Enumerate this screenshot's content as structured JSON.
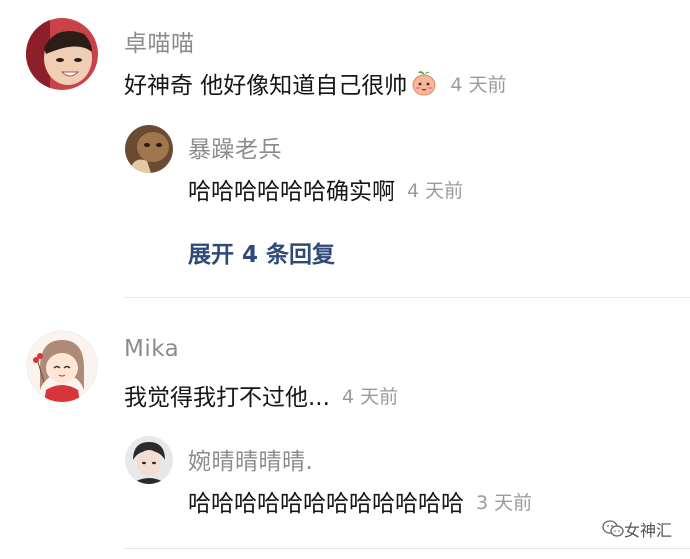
{
  "comments": [
    {
      "author": "卓喵喵",
      "text": "好神奇 他好像知道自己很帅",
      "emoji": "peach-face-icon",
      "time": "4 天前",
      "replies": [
        {
          "author": "暴躁老兵",
          "text": "哈哈哈哈哈哈确实啊",
          "time": "4 天前"
        }
      ],
      "expand_label": "展开 4 条回复"
    },
    {
      "author": "Mika",
      "text": "我觉得我打不过他...",
      "time": "4 天前",
      "replies": [
        {
          "author": "婉晴晴晴晴.",
          "text": "哈哈哈哈哈哈哈哈哈哈哈哈",
          "time": "3 天前"
        }
      ]
    }
  ],
  "watermark": {
    "icon": "wechat-icon",
    "label": "女神汇"
  },
  "colors": {
    "name": "#8c8c8c",
    "text": "#161616",
    "time": "#9b9b9b",
    "expand": "#2f4a78",
    "divider": "#e8e8e8"
  }
}
